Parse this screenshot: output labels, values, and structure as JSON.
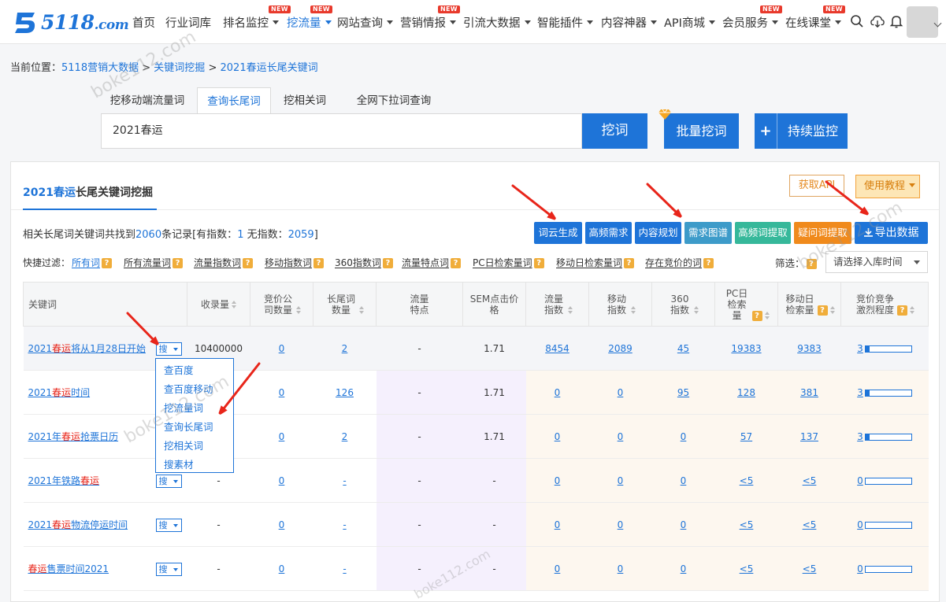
{
  "brand": {
    "logo_text": "5118",
    "logo_suffix": ".com",
    "color": "#1e74d8"
  },
  "nav": [
    {
      "label": "首页",
      "caret": false,
      "new": false,
      "active": false
    },
    {
      "label": "行业词库",
      "caret": false,
      "new": false,
      "active": false
    },
    {
      "label": "排名监控",
      "caret": true,
      "new": true,
      "active": false
    },
    {
      "label": "挖流量",
      "caret": true,
      "new": true,
      "active": true
    },
    {
      "label": "网站查询",
      "caret": true,
      "new": false,
      "active": false
    },
    {
      "label": "营销情报",
      "caret": true,
      "new": true,
      "active": false
    },
    {
      "label": "引流大数据",
      "caret": true,
      "new": false,
      "active": false
    },
    {
      "label": "智能插件",
      "caret": true,
      "new": false,
      "active": false
    },
    {
      "label": "内容神器",
      "caret": true,
      "new": false,
      "active": false
    },
    {
      "label": "API商城",
      "caret": true,
      "new": false,
      "active": false
    },
    {
      "label": "会员服务",
      "caret": true,
      "new": true,
      "active": false
    },
    {
      "label": "在线课堂",
      "caret": true,
      "new": true,
      "active": false
    }
  ],
  "new_badge": "NEW",
  "breadcrumb": {
    "prefix": "当前位置：",
    "items": [
      "5118营销大数据",
      "关键词挖掘",
      "2021春运长尾关键词"
    ],
    "sep": ">"
  },
  "search": {
    "tabs": [
      {
        "label": "挖移动端流量词",
        "active": false
      },
      {
        "label": "查询长尾词",
        "active": true
      },
      {
        "label": "挖相关词",
        "active": false
      },
      {
        "label": "全网下拉词查询",
        "active": false
      }
    ],
    "value": "2021春运",
    "dig_button": "挖词",
    "batch_button": "批量挖词",
    "monitor_plus": "+",
    "monitor_button": "持续监控"
  },
  "panel": {
    "title_highlight": "2021春运",
    "title_rest": "长尾关键词挖掘",
    "api_button": "获取API",
    "guide_button": "使用教程",
    "summary": {
      "pre": "相关长尾词关键词共找到",
      "total": "2060",
      "mid1": "条记录[有指数：",
      "with_index": "1",
      "mid2": " 无指数：",
      "without_index": "2059",
      "end": "]"
    },
    "actions": [
      {
        "label": "词云生成",
        "color": "#1e74d8"
      },
      {
        "label": "高频需求",
        "color": "#1e74d8"
      },
      {
        "label": "内容规划",
        "color": "#1e74d8"
      },
      {
        "label": "需求图谱",
        "color": "#3d9bc9"
      },
      {
        "label": "高频词提取",
        "color": "#36b89a"
      },
      {
        "label": "疑问词提取",
        "color": "#f08a1c"
      },
      {
        "label": "导出数据",
        "color": "#1e74d8"
      }
    ],
    "filter_label": "快捷过滤：",
    "filters": [
      "所有词",
      "所有流量词",
      "流量指数词",
      "移动指数词",
      "360指数词",
      "流量特点词",
      "PC日检索量词",
      "移动日检索量词",
      "存在竞价的词"
    ],
    "select_label": "筛选：",
    "select_placeholder": "请选择入库时间"
  },
  "table": {
    "headers": [
      "关键词",
      "收录量",
      "竞价公司数量",
      "长尾词数量",
      "流量特点",
      "SEM点击价格",
      "流量指数",
      "移动指数",
      "360指数",
      "PC日检索量",
      "移动日检索量",
      "竞价竞争激烈程度"
    ],
    "search_button": "搜",
    "rows": [
      {
        "kw": "2021春运将从1月28日开始",
        "hl": "春运",
        "shoulu": "10400000",
        "jingjia": "0",
        "changwei": "2",
        "tedian": "-",
        "sem": "1.71",
        "liuliang": "8454",
        "yidong": "2089",
        "s360": "45",
        "pc": "19383",
        "mobile": "9383",
        "comp": "3",
        "bar": 0.08
      },
      {
        "kw": "2021春运时间",
        "hl": "春运",
        "shoulu": "",
        "jingjia": "0",
        "changwei": "126",
        "tedian": "-",
        "sem": "1.71",
        "liuliang": "0",
        "yidong": "0",
        "s360": "95",
        "pc": "128",
        "mobile": "381",
        "comp": "3",
        "bar": 0.08
      },
      {
        "kw": "2021年春运抢票日历",
        "hl": "春运",
        "shoulu": "",
        "jingjia": "0",
        "changwei": "2",
        "tedian": "-",
        "sem": "1.71",
        "liuliang": "0",
        "yidong": "0",
        "s360": "0",
        "pc": "57",
        "mobile": "137",
        "comp": "3",
        "bar": 0.08
      },
      {
        "kw": "2021年铁路春运",
        "hl": "春运",
        "shoulu": "-",
        "jingjia": "0",
        "changwei": "-",
        "tedian": "-",
        "sem": "-",
        "liuliang": "0",
        "yidong": "0",
        "s360": "0",
        "pc": "<5",
        "mobile": "<5",
        "comp": "0",
        "bar": 0.0
      },
      {
        "kw": "2021春运物流停运时间",
        "hl": "春运",
        "shoulu": "-",
        "jingjia": "0",
        "changwei": "-",
        "tedian": "-",
        "sem": "-",
        "liuliang": "0",
        "yidong": "0",
        "s360": "0",
        "pc": "<5",
        "mobile": "<5",
        "comp": "0",
        "bar": 0.0
      },
      {
        "kw": "春运售票时间2021",
        "hl": "春运",
        "shoulu": "-",
        "jingjia": "0",
        "changwei": "-",
        "tedian": "-",
        "sem": "-",
        "liuliang": "0",
        "yidong": "0",
        "s360": "0",
        "pc": "<5",
        "mobile": "<5",
        "comp": "0",
        "bar": 0.0
      }
    ]
  },
  "dropdown": [
    "查百度",
    "查百度移动",
    "挖流量词",
    "查询长尾词",
    "挖相关词",
    "搜素材"
  ],
  "watermarks": [
    "boke112.com",
    "boke112.com",
    "boke112.com",
    "boke112.com",
    "boke112.com"
  ]
}
